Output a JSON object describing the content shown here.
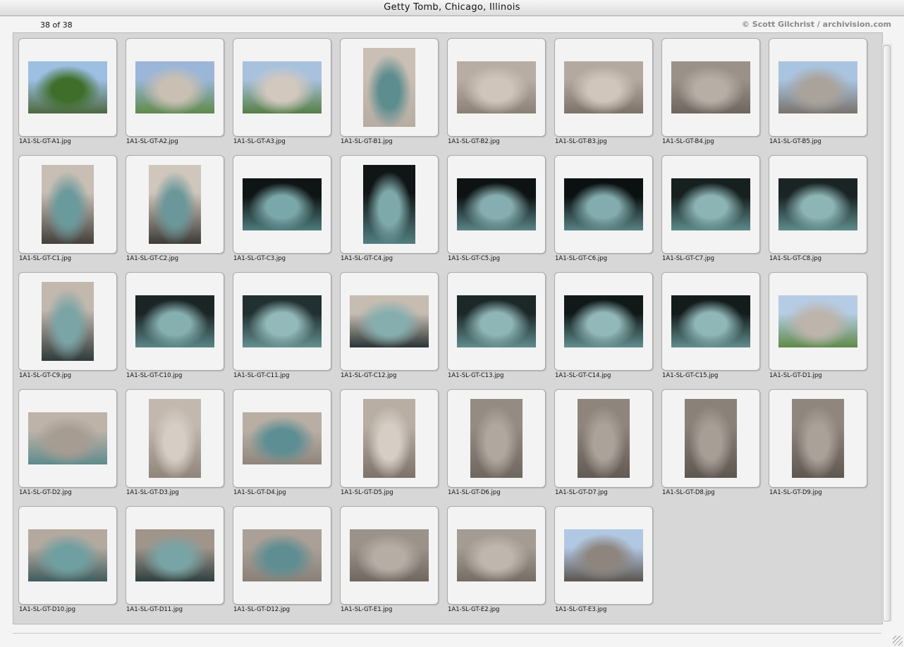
{
  "window": {
    "title": "Getty Tomb, Chicago, Illinois"
  },
  "header": {
    "count": "38 of 38",
    "copyright": "© Scott Gilchrist / archivision.com"
  },
  "thumbnails": [
    {
      "label": "1A1-SL-GT-A1.jpg",
      "orientation": "landscape",
      "palette": [
        "#9cbfe2",
        "#3f6e2a",
        "#4d6840"
      ]
    },
    {
      "label": "1A1-SL-GT-A2.jpg",
      "orientation": "landscape",
      "palette": [
        "#9bb6d8",
        "#c9bfb2",
        "#5f8a4a"
      ]
    },
    {
      "label": "1A1-SL-GT-A3.jpg",
      "orientation": "landscape",
      "palette": [
        "#a8c2de",
        "#d2c8bd",
        "#567f44"
      ]
    },
    {
      "label": "1A1-SL-GT-B1.jpg",
      "orientation": "portrait",
      "palette": [
        "#c9bfb4",
        "#5d8d8f",
        "#b5aca2"
      ]
    },
    {
      "label": "1A1-SL-GT-B2.jpg",
      "orientation": "landscape",
      "palette": [
        "#b8ada3",
        "#cfc5bb",
        "#8a8076"
      ]
    },
    {
      "label": "1A1-SL-GT-B3.jpg",
      "orientation": "landscape",
      "palette": [
        "#b3a99f",
        "#d0c6bc",
        "#7c7268"
      ]
    },
    {
      "label": "1A1-SL-GT-B4.jpg",
      "orientation": "landscape",
      "palette": [
        "#9a9189",
        "#b7aea5",
        "#6d655e"
      ]
    },
    {
      "label": "1A1-SL-GT-B5.jpg",
      "orientation": "landscape",
      "palette": [
        "#a9c4e0",
        "#aaa39b",
        "#7a736c"
      ]
    },
    {
      "label": "1A1-SL-GT-C1.jpg",
      "orientation": "portrait",
      "palette": [
        "#c7beb4",
        "#6b9a9c",
        "#433f3b"
      ]
    },
    {
      "label": "1A1-SL-GT-C2.jpg",
      "orientation": "portrait",
      "palette": [
        "#cfc6bc",
        "#6a9799",
        "#3d3a36"
      ]
    },
    {
      "label": "1A1-SL-GT-C3.jpg",
      "orientation": "landscape",
      "palette": [
        "#0f1414",
        "#7aa8aa",
        "#4f7b7d"
      ]
    },
    {
      "label": "1A1-SL-GT-C4.jpg",
      "orientation": "portrait",
      "palette": [
        "#101515",
        "#7ea9ab",
        "#527e80"
      ]
    },
    {
      "label": "1A1-SL-GT-C5.jpg",
      "orientation": "landscape",
      "palette": [
        "#0d1212",
        "#86aeb0",
        "#5a8587"
      ]
    },
    {
      "label": "1A1-SL-GT-C6.jpg",
      "orientation": "landscape",
      "palette": [
        "#0b1010",
        "#83acae",
        "#588385"
      ]
    },
    {
      "label": "1A1-SL-GT-C7.jpg",
      "orientation": "landscape",
      "palette": [
        "#16201f",
        "#8cb4b5",
        "#5e8a8b"
      ]
    },
    {
      "label": "1A1-SL-GT-C8.jpg",
      "orientation": "landscape",
      "palette": [
        "#1a2424",
        "#8db5b6",
        "#5f8b8c"
      ]
    },
    {
      "label": "1A1-SL-GT-C9.jpg",
      "orientation": "portrait",
      "palette": [
        "#c2b8ad",
        "#7aa4a5",
        "#2f3a3a"
      ]
    },
    {
      "label": "1A1-SL-GT-C10.jpg",
      "orientation": "landscape",
      "palette": [
        "#1b2525",
        "#86afb0",
        "#5a8687"
      ]
    },
    {
      "label": "1A1-SL-GT-C11.jpg",
      "orientation": "landscape",
      "palette": [
        "#213030",
        "#93b9ba",
        "#63908f"
      ]
    },
    {
      "label": "1A1-SL-GT-C12.jpg",
      "orientation": "landscape",
      "palette": [
        "#c6bcb1",
        "#86aeaf",
        "#2a3434"
      ]
    },
    {
      "label": "1A1-SL-GT-C13.jpg",
      "orientation": "landscape",
      "palette": [
        "#1c2727",
        "#8fb6b7",
        "#608c8d"
      ]
    },
    {
      "label": "1A1-SL-GT-C14.jpg",
      "orientation": "landscape",
      "palette": [
        "#101818",
        "#92b8b9",
        "#628e8f"
      ]
    },
    {
      "label": "1A1-SL-GT-C15.jpg",
      "orientation": "landscape",
      "palette": [
        "#131b1b",
        "#90b7b8",
        "#618d8e"
      ]
    },
    {
      "label": "1A1-SL-GT-D1.jpg",
      "orientation": "landscape",
      "palette": [
        "#b5cce4",
        "#bdb4ab",
        "#5f8a49"
      ]
    },
    {
      "label": "1A1-SL-GT-D2.jpg",
      "orientation": "landscape",
      "palette": [
        "#bdb3a9",
        "#a69c92",
        "#5f8b8c"
      ]
    },
    {
      "label": "1A1-SL-GT-D3.jpg",
      "orientation": "portrait",
      "palette": [
        "#c2b8ae",
        "#d6cdc4",
        "#8f857b"
      ]
    },
    {
      "label": "1A1-SL-GT-D4.jpg",
      "orientation": "landscape",
      "palette": [
        "#b8aea4",
        "#5c8e93",
        "#8f857c"
      ]
    },
    {
      "label": "1A1-SL-GT-D5.jpg",
      "orientation": "portrait",
      "palette": [
        "#b8aea4",
        "#d6cdc4",
        "#7c7269"
      ]
    },
    {
      "label": "1A1-SL-GT-D6.jpg",
      "orientation": "portrait",
      "palette": [
        "#948b83",
        "#b0a79e",
        "#6f675f"
      ]
    },
    {
      "label": "1A1-SL-GT-D7.jpg",
      "orientation": "portrait",
      "palette": [
        "#8e857d",
        "#aba29a",
        "#615a53"
      ]
    },
    {
      "label": "1A1-SL-GT-D8.jpg",
      "orientation": "portrait",
      "palette": [
        "#8a8179",
        "#a79e96",
        "#5d5650"
      ]
    },
    {
      "label": "1A1-SL-GT-D9.jpg",
      "orientation": "portrait",
      "palette": [
        "#8f867e",
        "#aaa199",
        "#5e5750"
      ]
    },
    {
      "label": "1A1-SL-GT-D10.jpg",
      "orientation": "landscape",
      "palette": [
        "#b3a99f",
        "#6f9fa1",
        "#3f5d5e"
      ]
    },
    {
      "label": "1A1-SL-GT-D11.jpg",
      "orientation": "landscape",
      "palette": [
        "#9f958b",
        "#79a4a5",
        "#2f3f40"
      ]
    },
    {
      "label": "1A1-SL-GT-D12.jpg",
      "orientation": "landscape",
      "palette": [
        "#aaa097",
        "#5f8e92",
        "#888077"
      ]
    },
    {
      "label": "1A1-SL-GT-E1.jpg",
      "orientation": "landscape",
      "palette": [
        "#9b928a",
        "#b6ada5",
        "#6f6760"
      ]
    },
    {
      "label": "1A1-SL-GT-E2.jpg",
      "orientation": "landscape",
      "palette": [
        "#a49b92",
        "#bfb6ad",
        "#756d65"
      ]
    },
    {
      "label": "1A1-SL-GT-E3.jpg",
      "orientation": "landscape",
      "palette": [
        "#b1c8e2",
        "#8d857e",
        "#5b544e"
      ]
    }
  ]
}
